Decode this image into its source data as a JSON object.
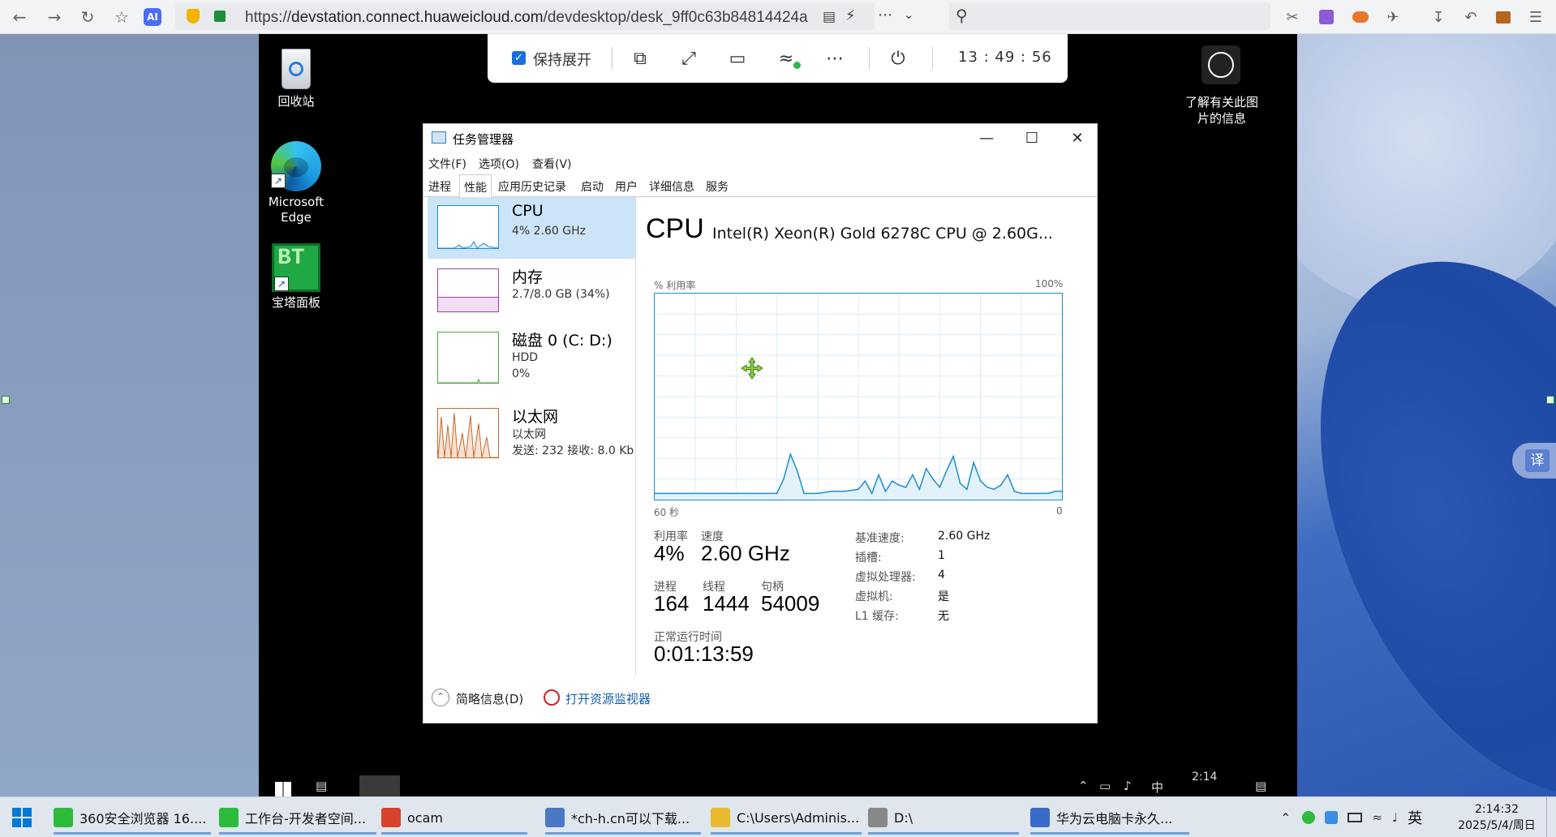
{
  "browser": {
    "url_prefix": "https://",
    "url_host": "devstation.connect.huaweicloud.com",
    "url_path": "/devdesktop/desk_9ff0c63b84814424a",
    "ai_label": "AI"
  },
  "remote_toolbar": {
    "keep_expanded_label": "保持展开",
    "time": "13 : 49 : 56"
  },
  "remote_desktop": {
    "icons": [
      {
        "label": "回收站"
      },
      {
        "label": "Microsoft Edge"
      },
      {
        "label": "宝塔面板"
      }
    ],
    "bt_text": "BT",
    "info_label": "了解有关此图片的信息",
    "taskbar_time": "2:14",
    "taskbar_ime": "中"
  },
  "task_manager": {
    "title": "任务管理器",
    "menu": [
      "文件(F)",
      "选项(O)",
      "查看(V)"
    ],
    "tabs": [
      "进程",
      "性能",
      "应用历史记录",
      "启动",
      "用户",
      "详细信息",
      "服务"
    ],
    "active_tab": "性能",
    "resources": [
      {
        "name": "CPU",
        "sub1": "4% 2.60 GHz",
        "sub2": "",
        "sub3": "",
        "color": "#1b8ecf"
      },
      {
        "name": "内存",
        "sub1": "2.7/8.0 GB (34%)",
        "sub2": "",
        "sub3": "",
        "color": "#9b3fa8"
      },
      {
        "name": "磁盘 0 (C: D:)",
        "sub1": "HDD",
        "sub2": "0%",
        "sub3": "",
        "color": "#4aa83f"
      },
      {
        "name": "以太网",
        "sub1": "以太网",
        "sub2": "发送: 232 接收: 8.0 Kb",
        "sub3": "",
        "color": "#c86a2b"
      }
    ],
    "detail": {
      "heading": "CPU",
      "model": "Intel(R) Xeon(R) Gold 6278C CPU @ 2.60G...",
      "y_label": "% 利用率",
      "y_max": "100%",
      "x_left": "60 秒",
      "x_right": "0",
      "util_label": "利用率",
      "util_value": "4%",
      "speed_label": "速度",
      "speed_value": "2.60 GHz",
      "proc_label": "进程",
      "proc_value": "164",
      "thread_label": "线程",
      "thread_value": "1444",
      "handle_label": "句柄",
      "handle_value": "54009",
      "uptime_label": "正常运行时间",
      "uptime_value": "0:01:13:59",
      "specs": [
        {
          "k": "基准速度:",
          "v": "2.60 GHz"
        },
        {
          "k": "插槽:",
          "v": "1"
        },
        {
          "k": "虚拟处理器:",
          "v": "4"
        },
        {
          "k": "虚拟机:",
          "v": "是"
        },
        {
          "k": "L1 缓存:",
          "v": "无"
        }
      ]
    },
    "footer": {
      "fewer_details": "简略信息(D)",
      "open_resmon": "打开资源监视器"
    }
  },
  "chart_data": {
    "type": "area",
    "title": "",
    "xlabel": "",
    "ylabel": "% 利用率",
    "ylim": [
      0,
      100
    ],
    "xlim": [
      60,
      0
    ],
    "x": [
      60,
      58,
      56,
      54,
      52,
      50,
      48,
      46,
      44,
      42,
      41,
      40,
      39,
      38,
      36,
      34,
      32,
      30,
      29,
      28,
      27,
      26,
      25,
      24,
      23,
      22,
      21,
      20,
      19,
      18,
      17,
      16,
      15,
      14,
      13,
      12,
      11,
      10,
      9,
      8,
      7,
      6,
      5,
      4,
      3,
      2,
      1,
      0
    ],
    "y": [
      3,
      3,
      3,
      3,
      3,
      3,
      3,
      3,
      3,
      3,
      10,
      22,
      14,
      3,
      3,
      4,
      4,
      5,
      9,
      3,
      12,
      4,
      9,
      7,
      6,
      12,
      5,
      15,
      10,
      6,
      14,
      21,
      8,
      5,
      18,
      9,
      6,
      5,
      7,
      12,
      4,
      3,
      3,
      3,
      3,
      3,
      4,
      4
    ],
    "grid": true,
    "color": "#1b8ecf"
  },
  "taskbar": {
    "items": [
      {
        "label": "360安全浏览器 16....",
        "icon_color": "#2dbb3a"
      },
      {
        "label": "工作台-开发者空间...",
        "icon_color": "#2dbb3a"
      },
      {
        "label": "ocam",
        "icon_color": "#d9432b"
      },
      {
        "label": "*ch-h.cn可以下载...",
        "icon_color": "#4a78c4"
      },
      {
        "label": "C:\\Users\\Adminis...",
        "icon_color": "#e9b92f"
      },
      {
        "label": "D:\\",
        "icon_color": "#888888"
      },
      {
        "label": "华为云电脑卡永久...",
        "icon_color": "#3a6bc8"
      }
    ],
    "ime": "英",
    "time": "2:14:32",
    "date": "2025/5/4/周日"
  },
  "translate_button": "译"
}
